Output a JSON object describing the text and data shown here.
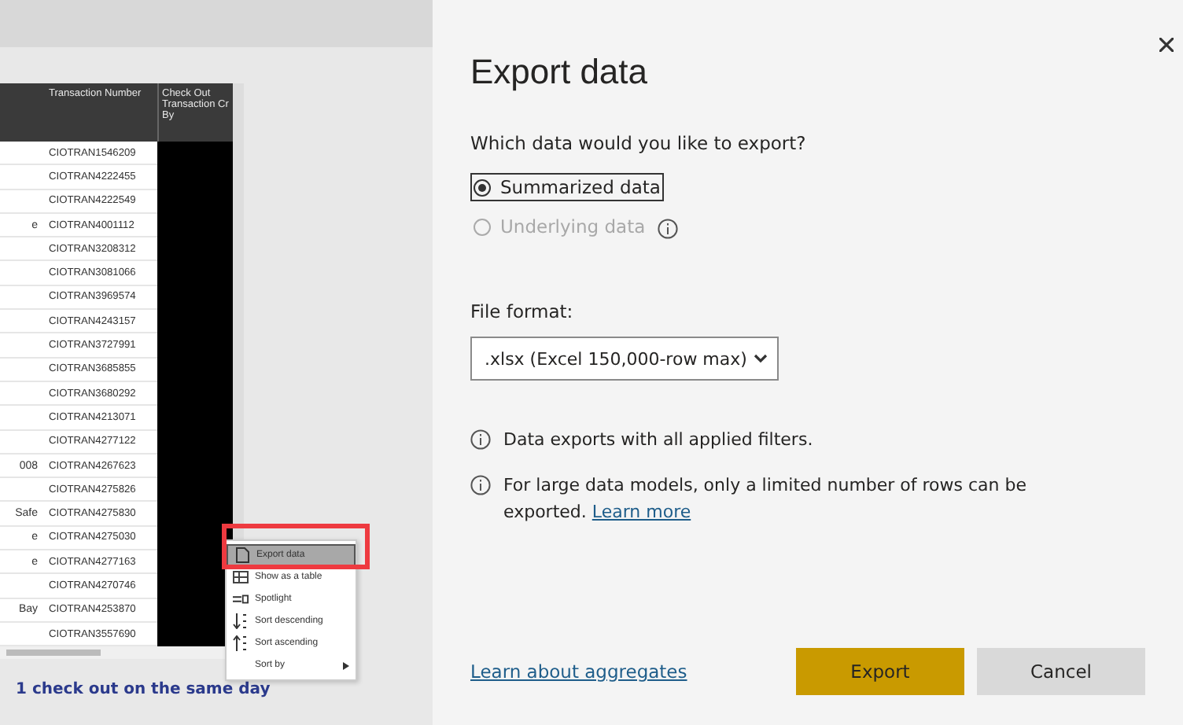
{
  "table": {
    "columns": [
      "Transaction Number",
      "Check Out Transaction Cr By"
    ],
    "rows": [
      {
        "transaction_number": "CIOTRAN1546209"
      },
      {
        "transaction_number": "CIOTRAN4222455"
      },
      {
        "transaction_number": "CIOTRAN4222549"
      },
      {
        "column_1": "e",
        "transaction_number": "CIOTRAN4001112"
      },
      {
        "transaction_number": "CIOTRAN3208312"
      },
      {
        "transaction_number": "CIOTRAN3081066"
      },
      {
        "transaction_number": "CIOTRAN3969574"
      },
      {
        "transaction_number": "CIOTRAN4243157"
      },
      {
        "transaction_number": "CIOTRAN3727991"
      },
      {
        "transaction_number": "CIOTRAN3685855"
      },
      {
        "transaction_number": "CIOTRAN3680292"
      },
      {
        "transaction_number": "CIOTRAN4213071"
      },
      {
        "transaction_number": "CIOTRAN4277122"
      },
      {
        "column_1": "008",
        "transaction_number": "CIOTRAN4267623"
      },
      {
        "transaction_number": "CIOTRAN4275826"
      },
      {
        "column_1": "Safe",
        "transaction_number": "CIOTRAN4275830"
      },
      {
        "column_1": "e",
        "transaction_number": "CIOTRAN4275030"
      },
      {
        "column_1": "e",
        "transaction_number": "CIOTRAN4277163"
      },
      {
        "transaction_number": "CIOTRAN4270746"
      },
      {
        "column_1": "Bay",
        "transaction_number": "CIOTRAN4253870"
      },
      {
        "transaction_number": "CIOTRAN3557690"
      }
    ]
  },
  "context_menu": [
    {
      "label": "Export data",
      "selected": true,
      "submenu": false
    },
    {
      "label": "Show as a table",
      "selected": false,
      "submenu": false
    },
    {
      "label": "Spotlight",
      "selected": false,
      "submenu": false
    },
    {
      "label": "Sort descending",
      "selected": false,
      "submenu": false
    },
    {
      "label": "Sort ascending",
      "selected": false,
      "submenu": false
    },
    {
      "label": "Sort by",
      "selected": false,
      "submenu": true
    }
  ],
  "visual_footer": "1 check out on the same day",
  "dialog": {
    "title": "Export data",
    "question": "Which data would you like to export?",
    "options": [
      {
        "label": "Summarized data",
        "selected": true,
        "disabled": false,
        "info": false
      },
      {
        "label": "Underlying data",
        "selected": false,
        "disabled": true,
        "info": true
      }
    ],
    "file_format": {
      "label": "File format:",
      "value": ".xlsx (Excel 150,000-row max)"
    },
    "notes": [
      {
        "text": "Data exports with all applied filters."
      },
      {
        "text": "For large data models, only a limited number of rows can be exported.",
        "link": "Learn more"
      }
    ],
    "footer_link": "Learn about aggregates",
    "buttons": [
      {
        "label": "Export",
        "kind": "primary"
      },
      {
        "label": "Cancel",
        "kind": "secondary"
      }
    ]
  }
}
